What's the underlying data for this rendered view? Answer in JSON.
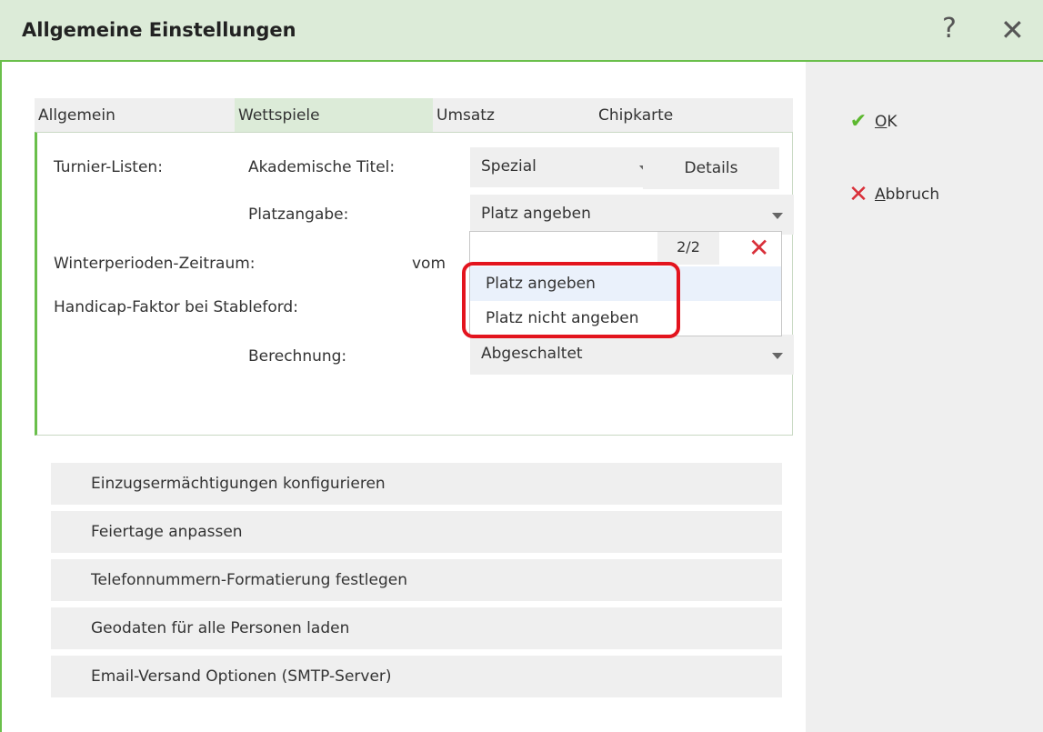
{
  "window": {
    "title": "Allgemeine Einstellungen",
    "help": "?",
    "close": "✕"
  },
  "actions": {
    "ok": "OK",
    "cancel": "Abbruch"
  },
  "tabs": [
    "Allgemein",
    "Wettspiele",
    "Umsatz",
    "Chipkarte"
  ],
  "active_tab": "Wettspiele",
  "form": {
    "turnier_label": "Turnier-Listen:",
    "akad_label": "Akademische Titel:",
    "akad_value": "Spezial",
    "details_btn": "Details",
    "platz_label": "Platzangabe:",
    "platz_value": "Platz angeben",
    "winter_label": "Winterperioden-Zeitraum:",
    "vom_label": "vom",
    "handicap_label": "Handicap-Faktor bei Stableford:",
    "berechnung_label": "Berechnung:",
    "berechnung_value": "Abgeschaltet"
  },
  "dropdown": {
    "count": "2/2",
    "options": [
      "Platz angeben",
      "Platz nicht angeben"
    ],
    "selected": "Platz angeben"
  },
  "buttons": [
    "Einzugsermächtigungen konfigurieren",
    "Feiertage anpassen",
    "Telefonnummern-Formatierung festlegen",
    "Geodaten für alle Personen laden",
    "Email-Versand Optionen (SMTP-Server)"
  ]
}
